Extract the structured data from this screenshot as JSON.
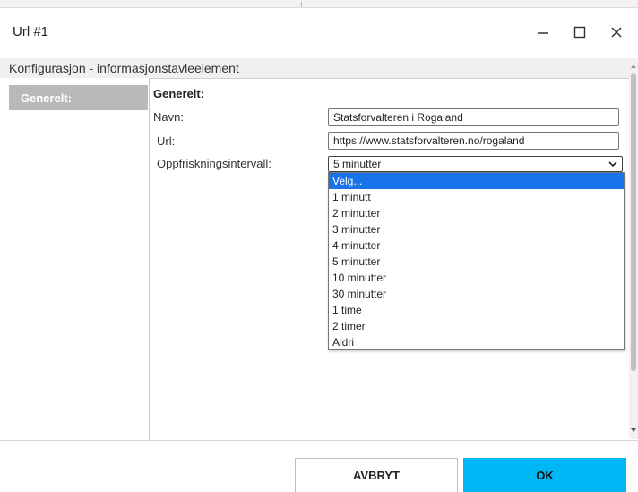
{
  "window": {
    "title": "Url #1"
  },
  "header": {
    "title": "Konfigurasjon - informasjonstavleelement"
  },
  "sidebar": {
    "items": [
      {
        "label": "Generelt:",
        "selected": true
      }
    ]
  },
  "form": {
    "section_title": "Generelt:",
    "name": {
      "label": "Navn:",
      "value": "Statsforvalteren i Rogaland"
    },
    "url": {
      "label": "Url:",
      "value": "https://www.statsforvalteren.no/rogaland"
    },
    "refresh": {
      "label": "Oppfriskningsintervall:",
      "selected": "5 minutter",
      "options": [
        "Velg...",
        "1 minutt",
        "2 minutter",
        "3 minutter",
        "4 minutter",
        "5 minutter",
        "10 minutter",
        "30 minutter",
        "1 time",
        "2 timer",
        "Aldri"
      ],
      "highlighted": "Velg..."
    }
  },
  "buttons": {
    "cancel": "AVBRYT",
    "ok": "OK"
  },
  "colors": {
    "accent": "#00b7f5",
    "highlight": "#1a73e8",
    "sidebar_selected": "#b9b9b9"
  }
}
